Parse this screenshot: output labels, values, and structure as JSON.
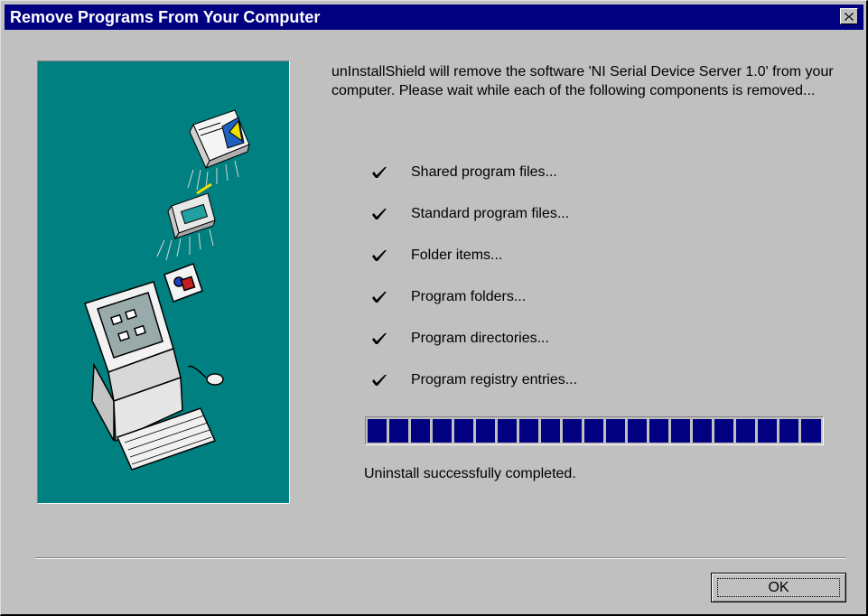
{
  "window": {
    "title": "Remove Programs From Your Computer"
  },
  "message": "unInstallShield will remove the software 'NI Serial Device Server 1.0' from your computer.  Please wait while each of the following components is removed...",
  "steps": [
    {
      "label": "Shared program files...",
      "done": true
    },
    {
      "label": "Standard program files...",
      "done": true
    },
    {
      "label": "Folder items...",
      "done": true
    },
    {
      "label": "Program folders...",
      "done": true
    },
    {
      "label": "Program directories...",
      "done": true
    },
    {
      "label": "Program registry entries...",
      "done": true
    }
  ],
  "progress": {
    "fraction": 1.0,
    "color": "#000080"
  },
  "status": "Uninstall successfully completed.",
  "buttons": {
    "ok_label": "OK"
  },
  "icons": {
    "close": "close-icon",
    "check": "check-icon"
  },
  "colors": {
    "titlebar": "#000080",
    "face": "#c0c0c0",
    "art_background": "#008080"
  }
}
